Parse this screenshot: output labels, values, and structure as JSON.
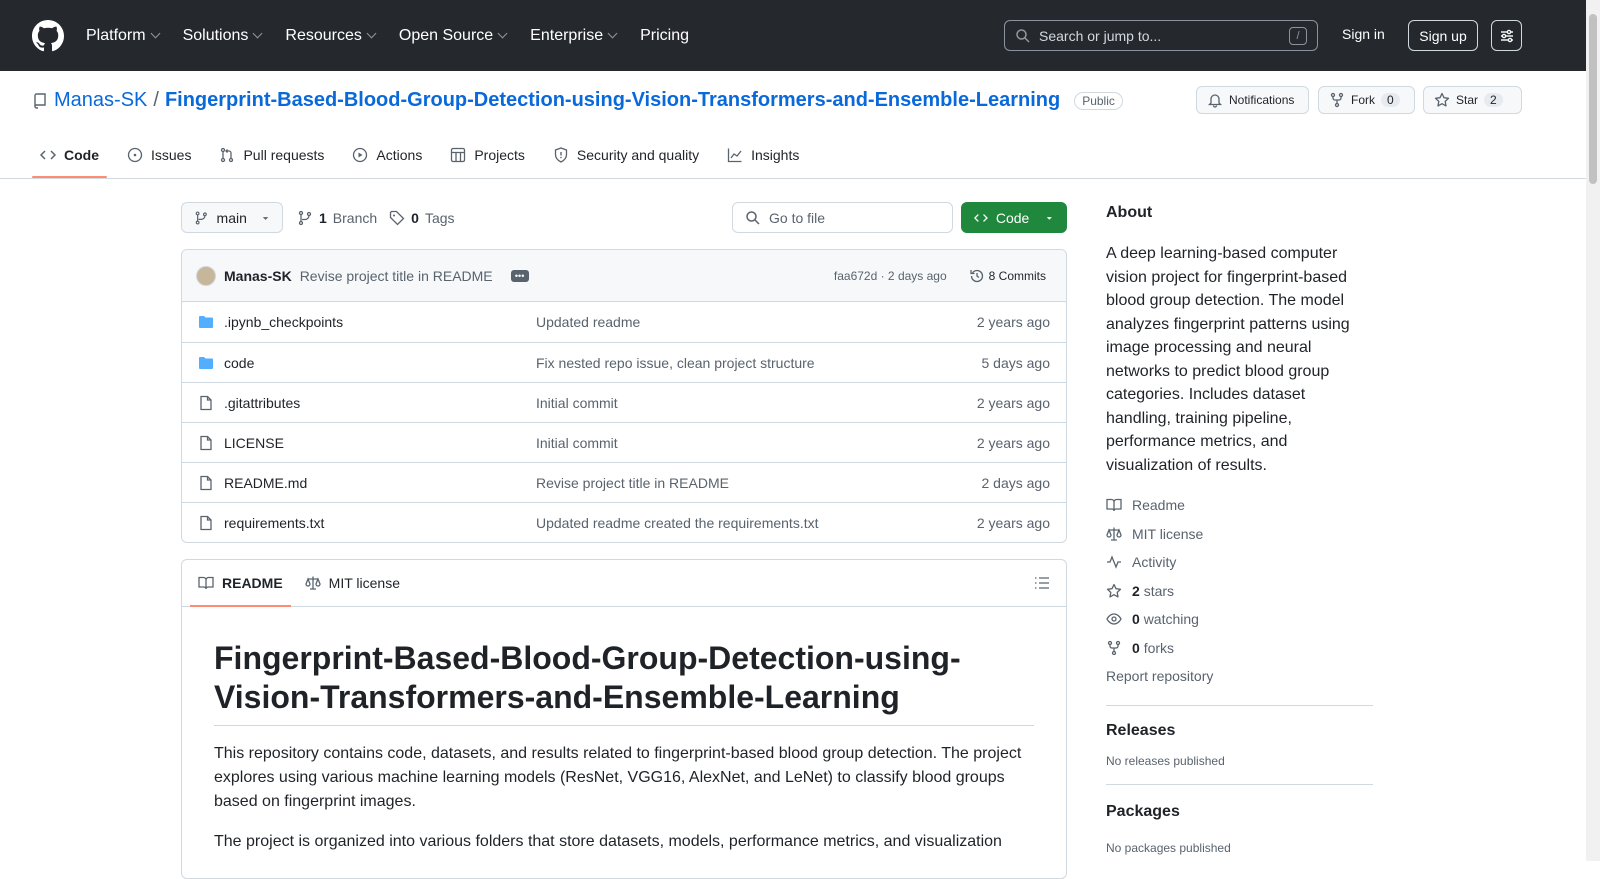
{
  "nav": {
    "items": [
      "Platform",
      "Solutions",
      "Resources",
      "Open Source",
      "Enterprise",
      "Pricing"
    ],
    "search_placeholder": "Search or jump to...",
    "search_key": "/",
    "signin": "Sign in",
    "signup": "Sign up"
  },
  "repo": {
    "owner": "Manas-SK",
    "separator": "/",
    "name": "Fingerprint-Based-Blood-Group-Detection-using-Vision-Transformers-and-Ensemble-Learning",
    "visibility": "Public",
    "notifications": "Notifications",
    "fork_label": "Fork",
    "fork_count": "0",
    "star_label": "Star",
    "star_count": "2"
  },
  "tabs": [
    "Code",
    "Issues",
    "Pull requests",
    "Actions",
    "Projects",
    "Security and quality",
    "Insights"
  ],
  "branch": {
    "name": "main",
    "branch_count": "1",
    "branch_label": "Branch",
    "tag_count": "0",
    "tag_label": "Tags",
    "goto_placeholder": "Go to file",
    "code_button": "Code"
  },
  "commit": {
    "author": "Manas-SK",
    "message": "Revise project title in README",
    "hash_time": "faa672d · 2 days ago",
    "commits": "8 Commits"
  },
  "files": [
    {
      "name": ".ipynb_checkpoints",
      "type": "dir",
      "msg": "Updated readme",
      "time": "2 years ago"
    },
    {
      "name": "code",
      "type": "dir",
      "msg": "Fix nested repo issue, clean project structure",
      "time": "5 days ago"
    },
    {
      "name": ".gitattributes",
      "type": "file",
      "msg": "Initial commit",
      "time": "2 years ago"
    },
    {
      "name": "LICENSE",
      "type": "file",
      "msg": "Initial commit",
      "time": "2 years ago"
    },
    {
      "name": "README.md",
      "type": "file",
      "msg": "Revise project title in README",
      "time": "2 days ago"
    },
    {
      "name": "requirements.txt",
      "type": "file",
      "msg": "Updated readme created the requirements.txt",
      "time": "2 years ago"
    }
  ],
  "readme": {
    "tab_readme": "README",
    "tab_license": "MIT license",
    "title": "Fingerprint-Based-Blood-Group-Detection-using-Vision-Transformers-and-Ensemble-Learning",
    "p1": "This repository contains code, datasets, and results related to fingerprint-based blood group detection. The project explores using various machine learning models (ResNet, VGG16, AlexNet, and LeNet) to classify blood groups based on fingerprint images.",
    "p2": "The project is organized into various folders that store datasets, models, performance metrics, and visualization"
  },
  "about": {
    "heading": "About",
    "description": "A deep learning-based computer vision project for fingerprint-based blood group detection. The model analyzes fingerprint patterns using image processing and neural networks to predict blood group categories. Includes dataset handling, training pipeline, performance metrics, and visualization of results.",
    "readme": "Readme",
    "license": "MIT license",
    "activity": "Activity",
    "stars_count": "2",
    "stars_label": "stars",
    "watching_count": "0",
    "watching_label": "watching",
    "forks_count": "0",
    "forks_label": "forks",
    "report": "Report repository"
  },
  "releases": {
    "heading": "Releases",
    "text": "No releases published"
  },
  "packages": {
    "heading": "Packages",
    "text": "No packages published"
  }
}
